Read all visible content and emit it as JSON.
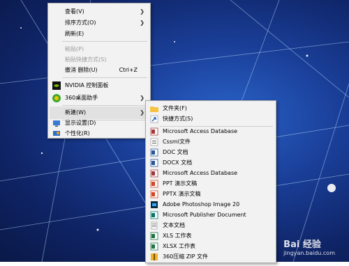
{
  "context_menu": {
    "items": [
      {
        "label": "查看(V)"
      },
      {
        "label": "排序方式(O)"
      },
      {
        "label": "刷新(E)"
      },
      {
        "label": "粘贴(P)"
      },
      {
        "label": "粘贴快捷方式(S)"
      },
      {
        "label": "撤消 删除(U)",
        "shortcut": "Ctrl+Z"
      },
      {
        "label": "NVIDIA 控制面板"
      },
      {
        "label": "360桌面助手"
      },
      {
        "label": "新建(W)"
      },
      {
        "label": "显示设置(D)"
      },
      {
        "label": "个性化(R)"
      }
    ]
  },
  "new_submenu": {
    "items": [
      {
        "label": "文件夹(F)"
      },
      {
        "label": "快捷方式(S)"
      },
      {
        "label": "Microsoft Access Database"
      },
      {
        "label": "Cssml文件"
      },
      {
        "label": "DOC 文档"
      },
      {
        "label": "DOCX 文档"
      },
      {
        "label": "Microsoft Access Database"
      },
      {
        "label": "PPT 演示文稿"
      },
      {
        "label": "PPTX 演示文稿"
      },
      {
        "label": "Adobe Photoshop Image 20"
      },
      {
        "label": "Microsoft Publisher Document"
      },
      {
        "label": "文本文档"
      },
      {
        "label": "XLS 工作表"
      },
      {
        "label": "XLSX 工作表"
      },
      {
        "label": "360压缩 ZIP 文件"
      }
    ]
  },
  "watermark": {
    "text": "Bai 经验",
    "url": "jingyan.baidu.com"
  },
  "colors": {
    "menu_bg": "#f2f2f2",
    "highlight": "#e1e1e1",
    "desktop": "#1a3f99"
  }
}
